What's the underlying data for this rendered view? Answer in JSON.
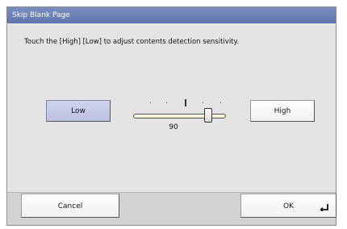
{
  "window": {
    "title": "Skip Blank Page"
  },
  "instruction": "Touch the [High] [Low] to adjust contents detection sensitivity.",
  "sensitivity": {
    "low_label": "Low",
    "high_label": "High",
    "value": "90",
    "level": 0.9,
    "selected": "Low"
  },
  "footer": {
    "cancel_label": "Cancel",
    "ok_label": "OK"
  },
  "icons": {
    "enter": "enter-return-icon"
  },
  "colors": {
    "titlebar": "#6a80b6",
    "selected_button": "#c6cae8",
    "panel": "#e4e4e4"
  }
}
